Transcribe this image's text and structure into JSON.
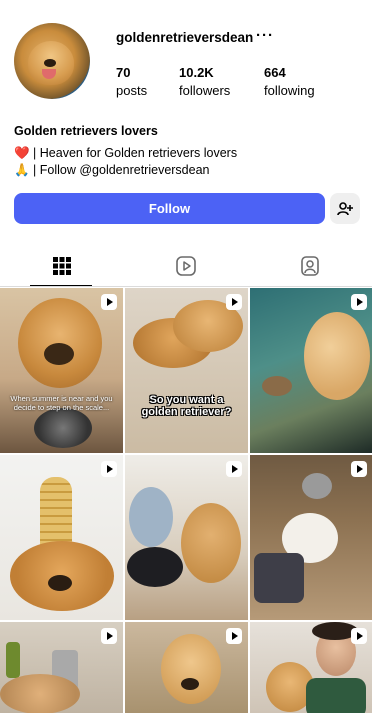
{
  "profile": {
    "username": "goldenretrieversdean",
    "more": "···",
    "stats": [
      {
        "value": "70",
        "label": "posts"
      },
      {
        "value": "10.2K",
        "label": "followers"
      },
      {
        "value": "664",
        "label": "following"
      }
    ]
  },
  "bio": {
    "name": "Golden retrievers lovers",
    "line1_emoji": "❤️",
    "line1": " | Heaven for Golden retrievers lovers",
    "line2_emoji": "🙏",
    "line2": " | Follow @goldenretrieversdean"
  },
  "actions": {
    "follow_label": "Follow"
  },
  "tabs": [
    {
      "icon": "grid-icon",
      "active": true
    },
    {
      "icon": "reels-icon",
      "active": false
    },
    {
      "icon": "tagged-icon",
      "active": false
    }
  ],
  "posts": [
    {
      "caption": "When summer is near and you decide to step on the scale...",
      "icon": "reel-icon"
    },
    {
      "caption": "So you want a golden retriever?",
      "icon": "reel-icon"
    },
    {
      "caption": "",
      "icon": "reel-icon"
    },
    {
      "caption": "",
      "icon": "reel-icon"
    },
    {
      "caption": "",
      "icon": "reel-icon"
    },
    {
      "caption": "",
      "icon": "reel-icon"
    },
    {
      "caption": "",
      "icon": "reel-icon"
    },
    {
      "caption": "",
      "icon": "reel-icon"
    },
    {
      "caption": "",
      "icon": "reel-icon"
    }
  ],
  "colors": {
    "follow_button": "#4c62f5",
    "secondary_button": "#efefef",
    "divider": "#dbdbdb"
  }
}
